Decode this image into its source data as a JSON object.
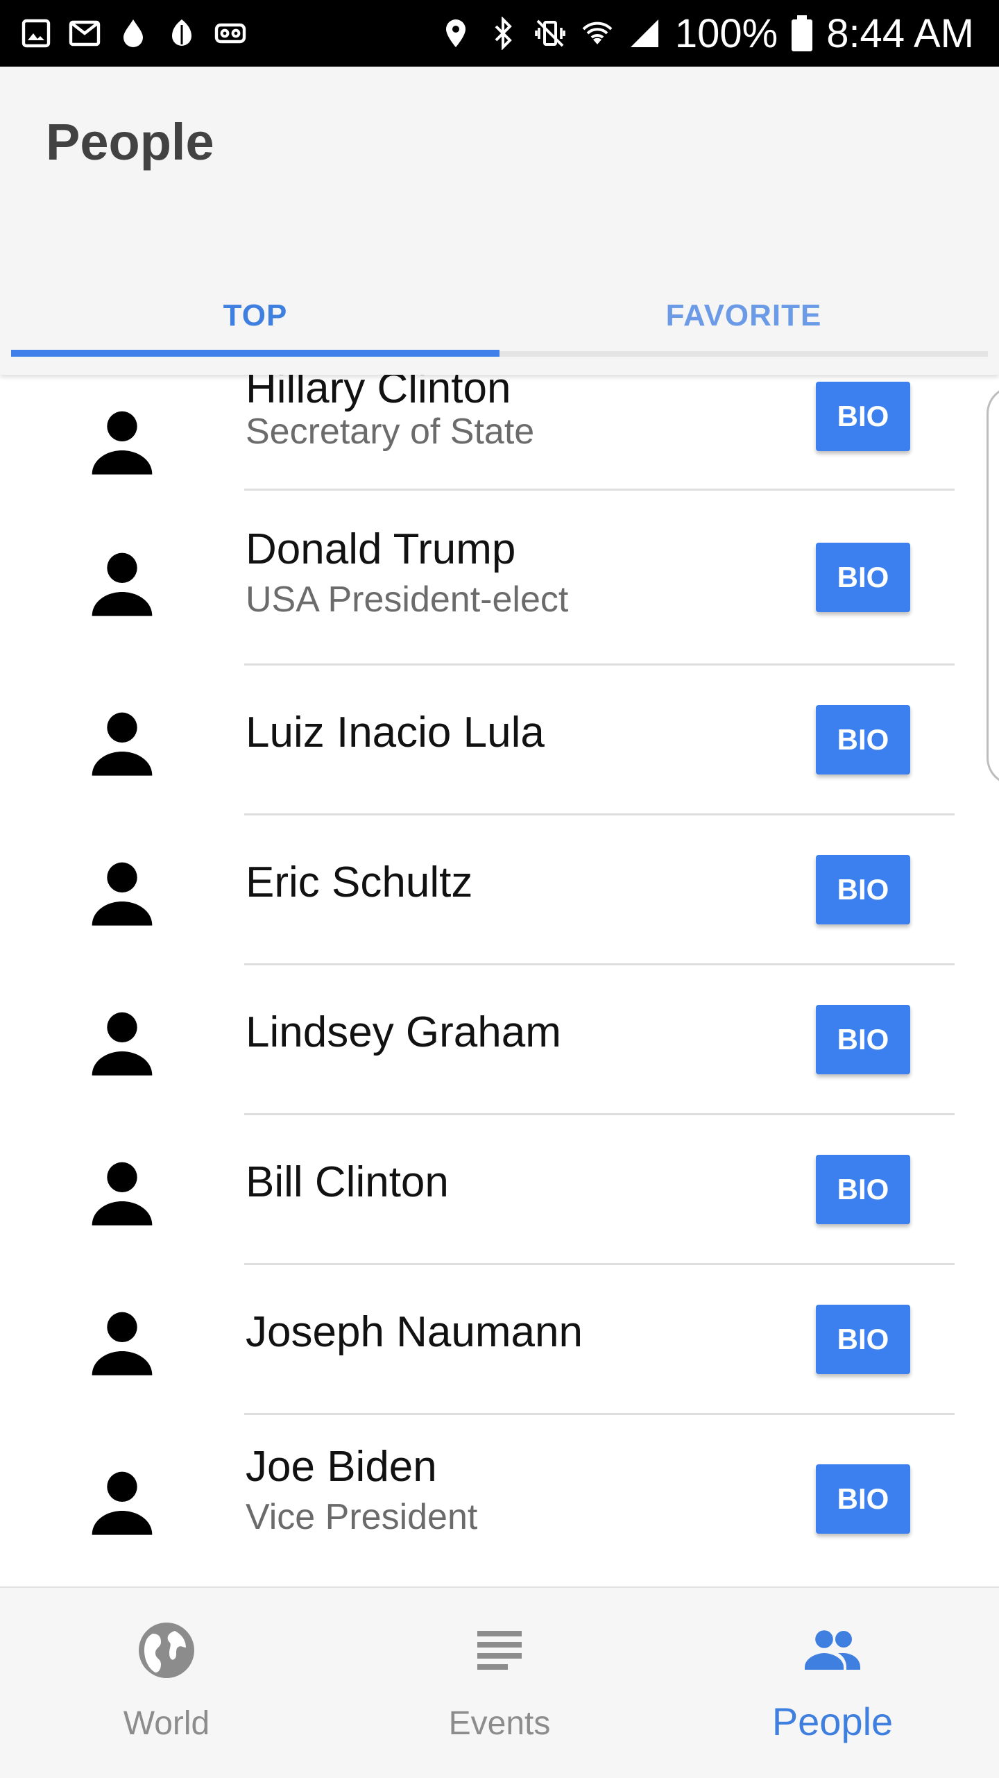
{
  "status_bar": {
    "left_icons": [
      "gallery-icon",
      "gmail-icon",
      "drop-icon",
      "leaf-icon",
      "voicemail-icon"
    ],
    "right_icons": [
      "location-icon",
      "bluetooth-icon",
      "vibrate-icon",
      "wifi-icon",
      "signal-icon"
    ],
    "battery": "100%",
    "time": "8:44 AM"
  },
  "header": {
    "title": "People"
  },
  "tabs": [
    {
      "label": "TOP",
      "active": true
    },
    {
      "label": "FAVORITE",
      "active": false
    }
  ],
  "people": [
    {
      "name": "Hillary Clinton",
      "subtitle": "Secretary of State",
      "button": "BIO"
    },
    {
      "name": "Donald Trump",
      "subtitle": "USA President-elect",
      "button": "BIO"
    },
    {
      "name": "Luiz Inacio Lula",
      "subtitle": "",
      "button": "BIO"
    },
    {
      "name": "Eric Schultz",
      "subtitle": "",
      "button": "BIO"
    },
    {
      "name": "Lindsey Graham",
      "subtitle": "",
      "button": "BIO"
    },
    {
      "name": "Bill Clinton",
      "subtitle": "",
      "button": "BIO"
    },
    {
      "name": "Joseph Naumann",
      "subtitle": "",
      "button": "BIO"
    },
    {
      "name": "Joe Biden",
      "subtitle": "Vice President",
      "button": "BIO"
    }
  ],
  "bottom_nav": [
    {
      "label": "World",
      "icon": "globe-icon",
      "active": false
    },
    {
      "label": "Events",
      "icon": "list-icon",
      "active": false
    },
    {
      "label": "People",
      "icon": "people-icon",
      "active": true
    }
  ],
  "colors": {
    "accent": "#3f80ea",
    "button": "#3b80ee",
    "appbar": "#f5f5f5",
    "status_bar": "#000000"
  }
}
